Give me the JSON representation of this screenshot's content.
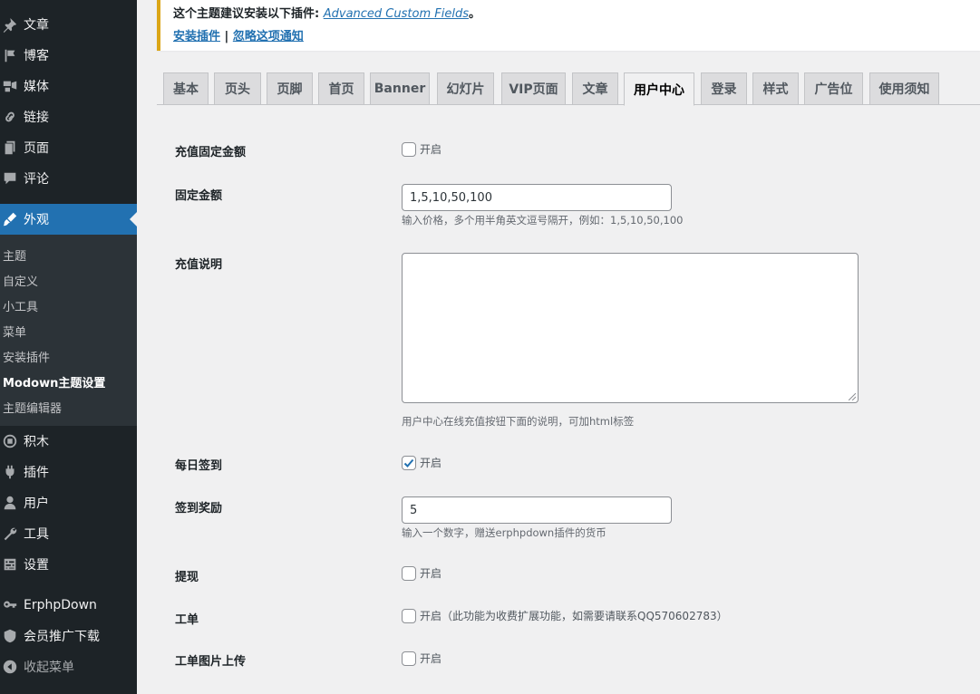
{
  "sidebar": {
    "items": [
      {
        "label": "文章",
        "icon": "pin-icon"
      },
      {
        "label": "博客",
        "icon": "flag-icon"
      },
      {
        "label": "媒体",
        "icon": "media-icon"
      },
      {
        "label": "链接",
        "icon": "link-icon"
      },
      {
        "label": "页面",
        "icon": "page-icon"
      },
      {
        "label": "评论",
        "icon": "comment-icon"
      },
      {
        "label": "外观",
        "icon": "brush-icon",
        "active": true
      },
      {
        "label": "积木",
        "icon": "blocks-icon"
      },
      {
        "label": "插件",
        "icon": "plugin-icon"
      },
      {
        "label": "用户",
        "icon": "user-icon"
      },
      {
        "label": "工具",
        "icon": "wrench-icon"
      },
      {
        "label": "设置",
        "icon": "settings-icon"
      },
      {
        "label": "ErphpDown",
        "icon": "key-icon"
      },
      {
        "label": "会员推广下载",
        "icon": "shield-icon"
      },
      {
        "label": "收起菜单",
        "icon": "collapse-icon"
      }
    ],
    "submenu": [
      "主题",
      "自定义",
      "小工具",
      "菜单",
      "安装插件",
      "Modown主题设置",
      "主题编辑器"
    ],
    "submenu_current": "Modown主题设置"
  },
  "notice": {
    "text": "这个主题建议安装以下插件: ",
    "plugin_link": "Advanced Custom Fields",
    "suffix": "。",
    "install_link": "安装插件",
    "separator": " | ",
    "dismiss_link": "忽略这项通知",
    "border_color": "#dba617"
  },
  "tabs": [
    "基本",
    "页头",
    "页脚",
    "首页",
    "Banner",
    "幻灯片",
    "VIP页面",
    "文章",
    "用户中心",
    "登录",
    "样式",
    "广告位",
    "使用须知"
  ],
  "active_tab": "用户中心",
  "form": {
    "fixed_amount_toggle": {
      "label": "充值固定金额",
      "checkbox_label": "开启",
      "checked": false
    },
    "fixed_amount": {
      "label": "固定金额",
      "value": "1,5,10,50,100",
      "desc": "输入价格，多个用半角英文逗号隔开，例如：1,5,10,50,100"
    },
    "recharge_desc": {
      "label": "充值说明",
      "value": "",
      "desc": "用户中心在线充值按钮下面的说明，可加html标签"
    },
    "daily_checkin": {
      "label": "每日签到",
      "checkbox_label": "开启",
      "checked": true
    },
    "checkin_reward": {
      "label": "签到奖励",
      "value": "5",
      "desc": "输入一个数字，赠送erphpdown插件的货币"
    },
    "withdraw": {
      "label": "提现",
      "checkbox_label": "开启",
      "checked": false
    },
    "ticket": {
      "label": "工单",
      "checkbox_label": "开启（此功能为收费扩展功能，如需要请联系QQ570602783）",
      "checked": false
    },
    "ticket_image": {
      "label": "工单图片上传",
      "checkbox_label": "开启",
      "checked": false
    }
  },
  "colors": {
    "accent": "#2271b1",
    "sidebar_bg": "#1d2327",
    "submenu_bg": "#2c3338",
    "page_bg": "#f0f0f1"
  }
}
